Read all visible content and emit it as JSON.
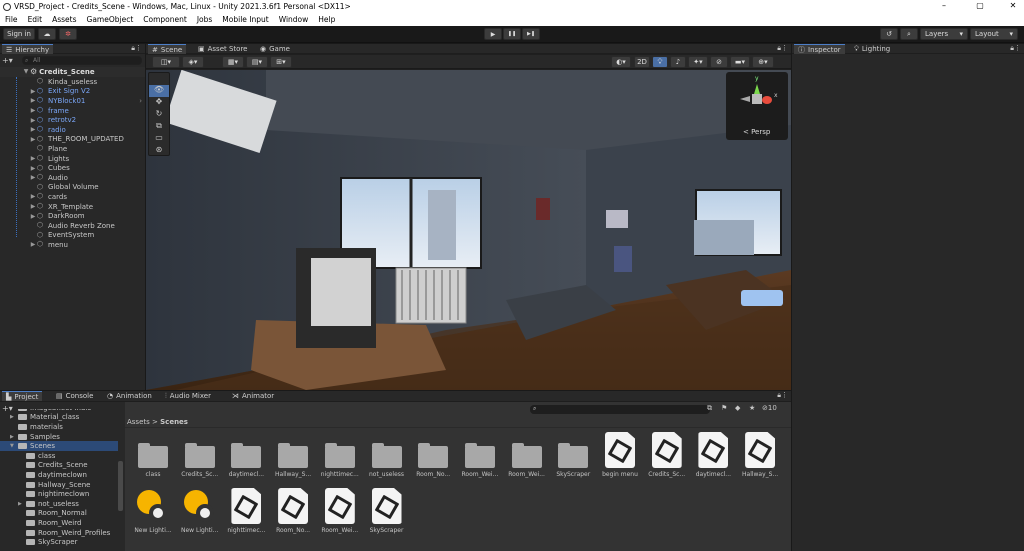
{
  "window": {
    "title": "VRSD_Project - Credits_Scene - Windows, Mac, Linux - Unity 2021.3.6f1 Personal <DX11>",
    "minimize": "–",
    "maximize": "▢",
    "close": "✕"
  },
  "menu": [
    "File",
    "Edit",
    "Assets",
    "GameObject",
    "Component",
    "Jobs",
    "Mobile Input",
    "Window",
    "Help"
  ],
  "toolbar": {
    "sign_in": "Sign in",
    "layers": "Layers",
    "layout": "Layout",
    "play": "▶",
    "pause": "❚❚",
    "step": "▶❚"
  },
  "hierarchy": {
    "tab": "Hierarchy",
    "search_placeholder": "All",
    "scene": "Credits_Scene",
    "items": [
      {
        "label": "Kinda_useless",
        "blue": false,
        "arrow": false
      },
      {
        "label": "Exit Sign V2",
        "blue": true,
        "arrow": true
      },
      {
        "label": "NYBlock01",
        "blue": true,
        "arrow": true
      },
      {
        "label": "frame",
        "blue": true,
        "arrow": true
      },
      {
        "label": "retrotv2",
        "blue": true,
        "arrow": true
      },
      {
        "label": "radio",
        "blue": true,
        "arrow": true
      },
      {
        "label": "THE_ROOM_UPDATED",
        "blue": false,
        "arrow": true
      },
      {
        "label": "Plane",
        "blue": false,
        "arrow": false
      },
      {
        "label": "Lights",
        "blue": false,
        "arrow": true
      },
      {
        "label": "Cubes",
        "blue": false,
        "arrow": true
      },
      {
        "label": "Audio",
        "blue": false,
        "arrow": true
      },
      {
        "label": "Global Volume",
        "blue": false,
        "arrow": false
      },
      {
        "label": "cards",
        "blue": false,
        "arrow": true
      },
      {
        "label": "XR_Template",
        "blue": false,
        "arrow": true
      },
      {
        "label": "DarkRoom",
        "blue": false,
        "arrow": true
      },
      {
        "label": "Audio Reverb Zone",
        "blue": false,
        "arrow": false
      },
      {
        "label": "EventSystem",
        "blue": false,
        "arrow": false
      },
      {
        "label": "menu",
        "blue": false,
        "arrow": true
      }
    ]
  },
  "scene_tabs": [
    "Scene",
    "Asset Store",
    "Game"
  ],
  "scene_view": {
    "mode_2d": "2D",
    "persp": "< Persp",
    "gizmo_y": "y",
    "gizmo_x": "x"
  },
  "right_tabs": [
    "Inspector",
    "Lighting"
  ],
  "bottom_tabs": [
    "Project",
    "Console",
    "Animation",
    "Audio Mixer",
    "Animator"
  ],
  "project_tree": [
    {
      "label": "ImageSheet Indic",
      "indent": 1,
      "arrow": false
    },
    {
      "label": "Material_class",
      "indent": 1,
      "arrow": true
    },
    {
      "label": "materials",
      "indent": 1,
      "arrow": false
    },
    {
      "label": "Samples",
      "indent": 1,
      "arrow": true
    },
    {
      "label": "Scenes",
      "indent": 1,
      "arrow": true,
      "selected": true
    },
    {
      "label": "class",
      "indent": 2,
      "arrow": false
    },
    {
      "label": "Credits_Scene",
      "indent": 2,
      "arrow": false
    },
    {
      "label": "daytimeclown",
      "indent": 2,
      "arrow": false
    },
    {
      "label": "Hallway_Scene",
      "indent": 2,
      "arrow": false
    },
    {
      "label": "nightimeclown",
      "indent": 2,
      "arrow": false
    },
    {
      "label": "not_useless",
      "indent": 2,
      "arrow": true
    },
    {
      "label": "Room_Normal",
      "indent": 2,
      "arrow": false
    },
    {
      "label": "Room_Weird",
      "indent": 2,
      "arrow": false
    },
    {
      "label": "Room_Weird_Profiles",
      "indent": 2,
      "arrow": false
    },
    {
      "label": "SkyScraper",
      "indent": 2,
      "arrow": false
    }
  ],
  "breadcrumb": {
    "root": "Assets",
    "sep": ">",
    "current": "Scenes"
  },
  "asset_count": "10",
  "assets_row1": [
    {
      "label": "class",
      "kind": "folder"
    },
    {
      "label": "Credits_Sc...",
      "kind": "folder"
    },
    {
      "label": "daytimecl...",
      "kind": "folder"
    },
    {
      "label": "Hallway_S...",
      "kind": "folder"
    },
    {
      "label": "nighttimec...",
      "kind": "folder"
    },
    {
      "label": "not_useless",
      "kind": "folder"
    },
    {
      "label": "Room_No...",
      "kind": "folder"
    },
    {
      "label": "Room_Wei...",
      "kind": "folder"
    },
    {
      "label": "Room_Wei...",
      "kind": "folder"
    },
    {
      "label": "SkyScraper",
      "kind": "folder"
    },
    {
      "label": "begin menu",
      "kind": "scene"
    },
    {
      "label": "Credits_Sc...",
      "kind": "scene"
    },
    {
      "label": "daytimecl...",
      "kind": "scene"
    },
    {
      "label": "Hallway_S...",
      "kind": "scene"
    }
  ],
  "assets_row2": [
    {
      "label": "New Lighti...",
      "kind": "light"
    },
    {
      "label": "New Lighti...",
      "kind": "light"
    },
    {
      "label": "nighttimec...",
      "kind": "scene"
    },
    {
      "label": "Room_No...",
      "kind": "scene"
    },
    {
      "label": "Room_Wei...",
      "kind": "scene"
    },
    {
      "label": "SkyScraper",
      "kind": "scene"
    }
  ]
}
